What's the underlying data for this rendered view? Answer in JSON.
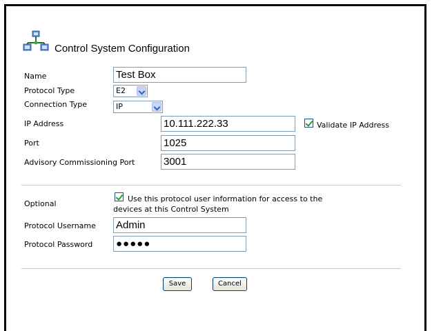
{
  "page": {
    "title": "Control System Configuration",
    "icon": "network-computers-icon"
  },
  "form": {
    "name": {
      "label": "Name",
      "value": "Test Box"
    },
    "protocol_type": {
      "label": "Protocol Type",
      "value": "E2"
    },
    "connection_type": {
      "label": "Connection Type",
      "value": "IP"
    },
    "ip_address": {
      "label": "IP Address",
      "value": "10.111.222.33"
    },
    "validate_ip": {
      "label": "Validate IP Address",
      "checked": true
    },
    "port": {
      "label": "Port",
      "value": "1025"
    },
    "advisory_port": {
      "label": "Advisory Commissioning Port",
      "value": "3001"
    }
  },
  "optional": {
    "label": "Optional",
    "use_protocol_user": {
      "label_line1": "Use this protocol user information for access to the",
      "label_line2": "devices at this Control System",
      "checked": true
    },
    "username": {
      "label": "Protocol Username",
      "value": "Admin"
    },
    "password": {
      "label": "Protocol Password",
      "value": "●●●●●"
    }
  },
  "buttons": {
    "save": "Save",
    "cancel": "Cancel"
  },
  "colors": {
    "input_border": "#7f9db9",
    "check_green": "#21a121",
    "dropdown_arrow_bg": "#c4d6fb"
  }
}
